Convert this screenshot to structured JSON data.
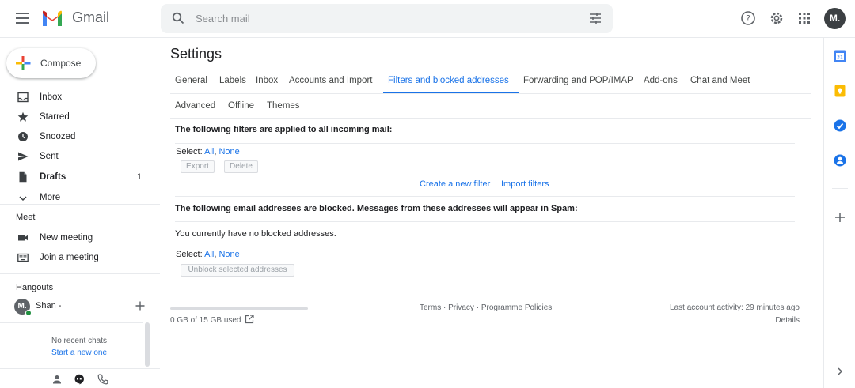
{
  "header": {
    "brand": "Gmail",
    "search_placeholder": "Search mail",
    "avatar_initial": "M."
  },
  "icons": {
    "menu": "hamburger-menu-icon",
    "logo": "gmail-logo-icon",
    "search": "search-icon",
    "tune": "tune-icon",
    "help": "help-icon",
    "settings": "gear-icon",
    "apps": "apps-grid-icon"
  },
  "colors": {
    "accent": "#1a73e8",
    "red": "#ea4335",
    "yellow": "#fbbc04",
    "green": "#34a853",
    "blue": "#4285f4"
  },
  "sidebar": {
    "compose_label": "Compose",
    "items": [
      {
        "label": "Inbox",
        "count": ""
      },
      {
        "label": "Starred",
        "count": ""
      },
      {
        "label": "Snoozed",
        "count": ""
      },
      {
        "label": "Sent",
        "count": ""
      },
      {
        "label": "Drafts",
        "count": "1"
      },
      {
        "label": "More",
        "count": ""
      }
    ],
    "meet_title": "Meet",
    "meet_items": [
      {
        "label": "New meeting"
      },
      {
        "label": "Join a meeting"
      }
    ],
    "hangouts_title": "Hangouts",
    "hangout_user": {
      "initial": "M.",
      "name": "Shan -"
    },
    "no_chats": "No recent chats",
    "start_new": "Start a new one"
  },
  "main": {
    "title": "Settings",
    "tabs_row1": [
      {
        "label": "General"
      },
      {
        "label": "Labels"
      },
      {
        "label": "Inbox"
      },
      {
        "label": "Accounts and Import"
      },
      {
        "label": "Filters and blocked addresses"
      },
      {
        "label": "Forwarding and POP/IMAP"
      },
      {
        "label": "Add-ons"
      },
      {
        "label": "Chat and Meet"
      }
    ],
    "tabs_row2": [
      {
        "label": "Advanced"
      },
      {
        "label": "Offline"
      },
      {
        "label": "Themes"
      }
    ],
    "filters": {
      "heading": "The following filters are applied to all incoming mail:",
      "select_prefix": "Select: ",
      "select_all": "All",
      "separator": ", ",
      "select_none": "None",
      "export_btn": "Export",
      "delete_btn": "Delete",
      "create_link": "Create a new filter",
      "import_link": "Import filters"
    },
    "blocked": {
      "heading": "The following email addresses are blocked. Messages from these addresses will appear in Spam:",
      "empty_text": "You currently have no blocked addresses.",
      "select_prefix": "Select: ",
      "select_all": "All",
      "separator": ", ",
      "select_none": "None",
      "unblock_btn": "Unblock selected addresses"
    },
    "footer": {
      "storage": "0 GB of 15 GB used",
      "terms": "Terms",
      "dot": " · ",
      "privacy": "Privacy",
      "policies": "Programme Policies",
      "last_activity": "Last account activity: 29 minutes ago",
      "details": "Details"
    }
  },
  "right_rail": {
    "icons": [
      "calendar-icon",
      "keep-icon",
      "tasks-icon",
      "contacts-icon",
      "add-icon",
      "expand-icon"
    ]
  }
}
